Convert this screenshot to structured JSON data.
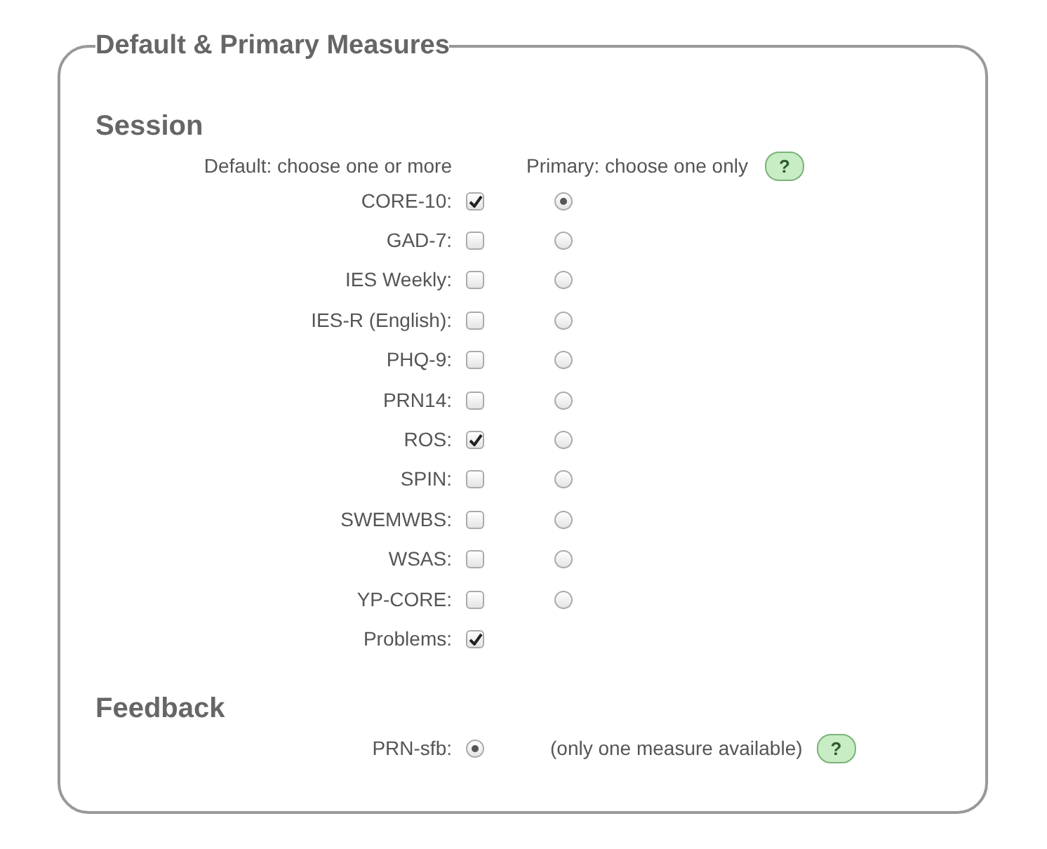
{
  "legend": "Default & Primary Measures",
  "session": {
    "title": "Session",
    "default_header": "Default: choose one or more",
    "primary_header": "Primary: choose one only",
    "help": "?",
    "measures": [
      {
        "kind": "both",
        "label": "CORE-10:",
        "checked": true,
        "selected": true
      },
      {
        "kind": "both",
        "label": "GAD-7:",
        "checked": false,
        "selected": false
      },
      {
        "kind": "both",
        "label": "IES Weekly:",
        "checked": false,
        "selected": false
      },
      {
        "kind": "both",
        "label": "IES-R (English):",
        "checked": false,
        "selected": false
      },
      {
        "kind": "both",
        "label": "PHQ-9:",
        "checked": false,
        "selected": false
      },
      {
        "kind": "both",
        "label": "PRN14:",
        "checked": false,
        "selected": false
      },
      {
        "kind": "both",
        "label": "ROS:",
        "checked": true,
        "selected": false
      },
      {
        "kind": "both",
        "label": "SPIN:",
        "checked": false,
        "selected": false
      },
      {
        "kind": "both",
        "label": "SWEMWBS:",
        "checked": false,
        "selected": false
      },
      {
        "kind": "both",
        "label": "WSAS:",
        "checked": false,
        "selected": false
      },
      {
        "kind": "both",
        "label": "YP-CORE:",
        "checked": false,
        "selected": false
      },
      {
        "kind": "checkbox",
        "label": "Problems:",
        "checked": true
      }
    ]
  },
  "feedback": {
    "title": "Feedback",
    "measures": [
      {
        "label": "PRN-sfb:",
        "selected": true
      }
    ],
    "note": "(only one measure available)",
    "help": "?"
  }
}
